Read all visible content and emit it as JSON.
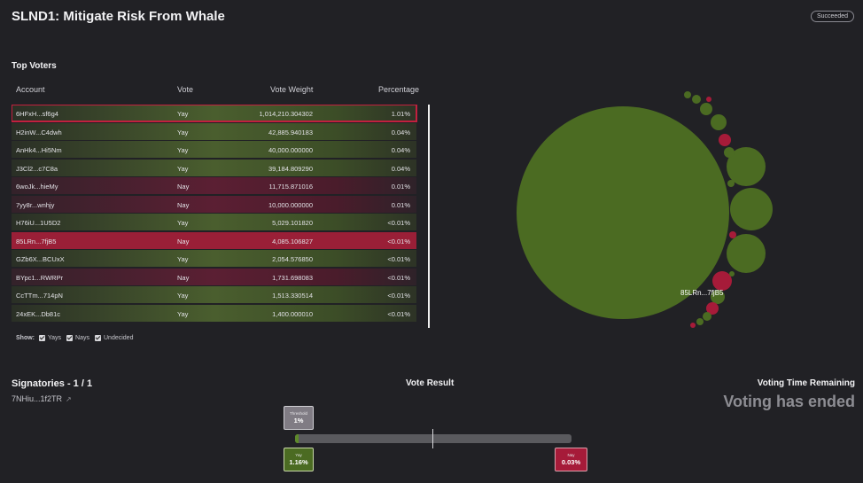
{
  "proposal": {
    "title": "SLND1: Mitigate Risk From Whale",
    "status": "Succeeded"
  },
  "top_voters": {
    "title": "Top Voters",
    "columns": [
      "Account",
      "Vote",
      "Vote Weight",
      "Percentage"
    ],
    "rows": [
      {
        "account": "6HFxH...sf6g4",
        "vote": "Yay",
        "weight": "1,014,210.304302",
        "pct": "1.01%"
      },
      {
        "account": "H2inW...C4dwh",
        "vote": "Yay",
        "weight": "42,885.940183",
        "pct": "0.04%"
      },
      {
        "account": "AnHk4...Hi5Nm",
        "vote": "Yay",
        "weight": "40,000.000000",
        "pct": "0.04%"
      },
      {
        "account": "J3Cl2...c7C8a",
        "vote": "Yay",
        "weight": "39,184.809290",
        "pct": "0.04%"
      },
      {
        "account": "6woJk...hieMy",
        "vote": "Nay",
        "weight": "11,715.871016",
        "pct": "0.01%"
      },
      {
        "account": "7yy8r...wnhjy",
        "vote": "Nay",
        "weight": "10,000.000000",
        "pct": "0.01%"
      },
      {
        "account": "H76iU...1U5D2",
        "vote": "Yay",
        "weight": "5,029.101820",
        "pct": "<0.01%"
      },
      {
        "account": "85LRn...7fjB5",
        "vote": "Nay",
        "weight": "4,085.106827",
        "pct": "<0.01%"
      },
      {
        "account": "GZb6X...BCUxX",
        "vote": "Yay",
        "weight": "2,054.576850",
        "pct": "<0.01%"
      },
      {
        "account": "BYpc1...RWRPr",
        "vote": "Nay",
        "weight": "1,731.698083",
        "pct": "<0.01%"
      },
      {
        "account": "CcTTm...714pN",
        "vote": "Yay",
        "weight": "1,513.330514",
        "pct": "<0.01%"
      },
      {
        "account": "24xEK...Db81c",
        "vote": "Yay",
        "weight": "1,400.000010",
        "pct": "<0.01%"
      }
    ],
    "show": {
      "label": "Show:",
      "options": [
        {
          "label": "Yays",
          "checked": true
        },
        {
          "label": "Nays",
          "checked": true
        },
        {
          "label": "Undecided",
          "checked": true
        }
      ]
    }
  },
  "bubble_chart": {
    "hover_label": "85LRn...7fjB5",
    "colors": {
      "yay": "#4b6b22",
      "nay": "#a61b39"
    }
  },
  "signatories": {
    "title": "Signatories - 1 / 1",
    "address": "7NHiu...1f2TR",
    "icon": "external-link-icon"
  },
  "vote_result": {
    "title": "Vote Result",
    "threshold_label": "Threshold",
    "threshold_value": "1%",
    "yay_label": "Yay",
    "yay_value": "1.16%",
    "nay_label": "Nay",
    "nay_value": "0.03%",
    "colors": {
      "yay": "#4b6b22",
      "nay": "#a61b39",
      "threshold": "#807c84"
    }
  },
  "voting_time": {
    "title": "Voting Time Remaining",
    "value": "Voting has ended"
  }
}
